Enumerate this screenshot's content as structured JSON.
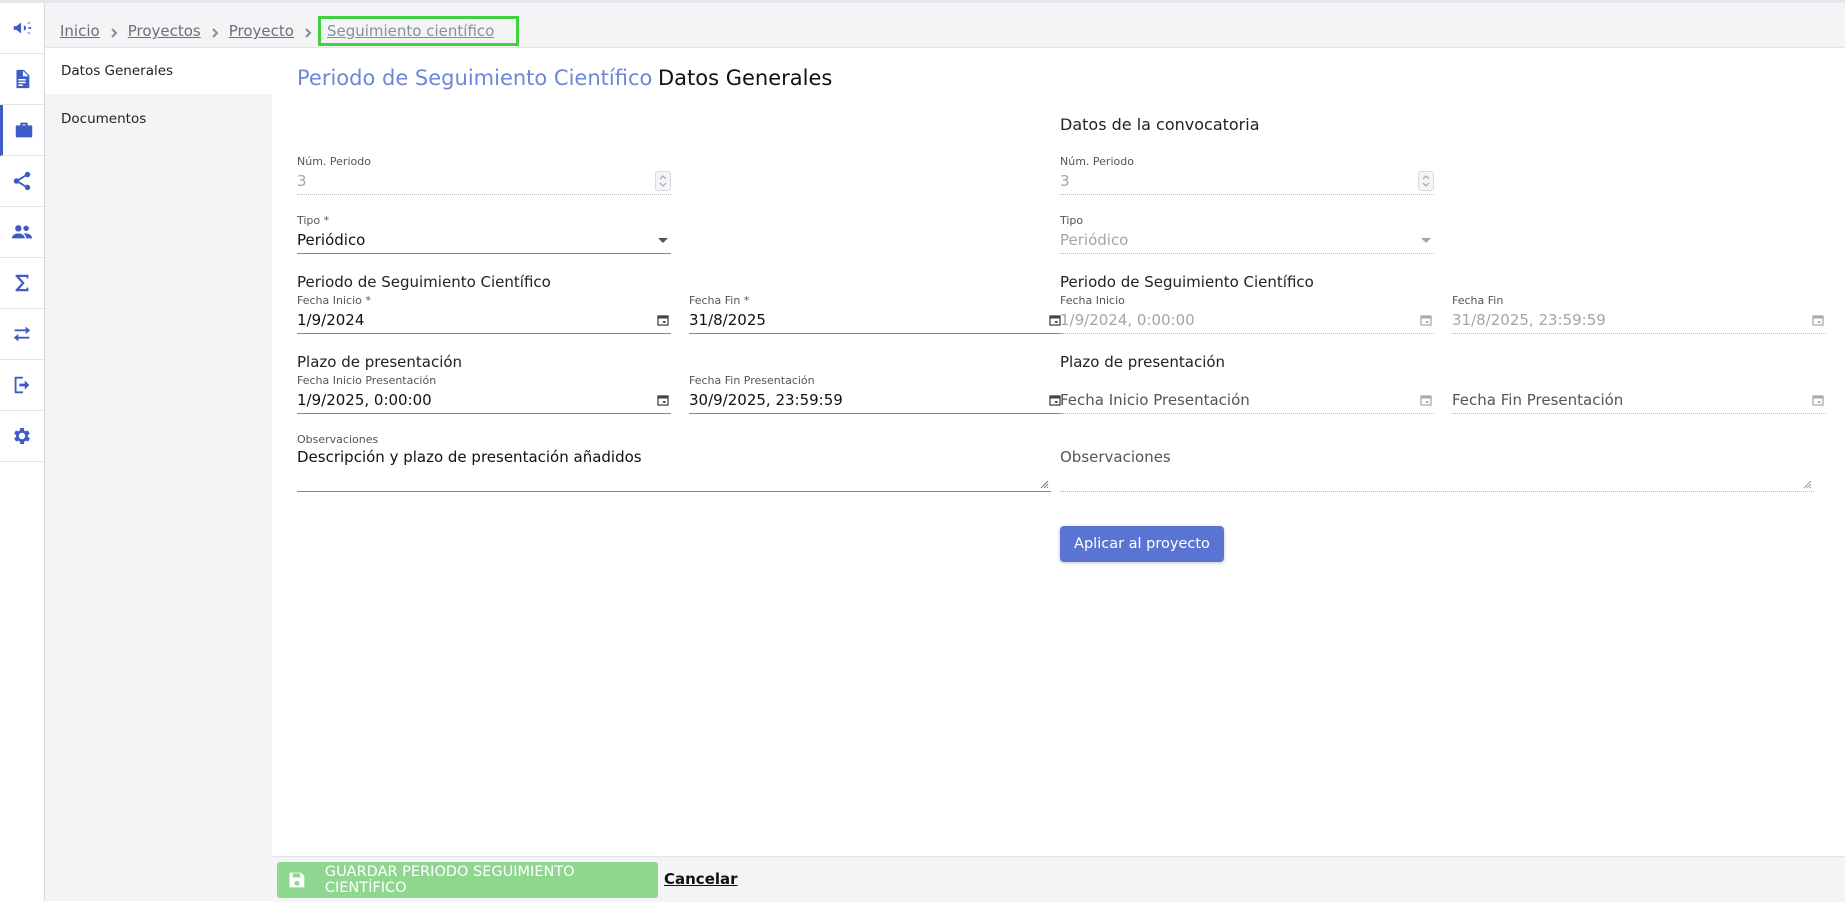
{
  "breadcrumb": {
    "items": [
      "Inicio",
      "Proyectos",
      "Proyecto"
    ],
    "current": "Seguimiento científico"
  },
  "rail": {
    "icons": [
      "megaphone-icon",
      "document-icon",
      "briefcase-icon",
      "share-icon",
      "people-icon",
      "sigma-icon",
      "transfer-icon",
      "logout-icon",
      "gear-icon"
    ],
    "active_index": 2
  },
  "sidenav": {
    "items": [
      "Datos Generales",
      "Documentos"
    ]
  },
  "page": {
    "title_primary": "Periodo de Seguimiento Científico",
    "title_secondary": "Datos Generales"
  },
  "left": {
    "num_periodo_label": "Núm. Periodo",
    "num_periodo_value": "3",
    "tipo_label": "Tipo *",
    "tipo_value": "Periódico",
    "periodo_heading": "Periodo de Seguimiento Científico",
    "fecha_inicio_label": "Fecha Inicio *",
    "fecha_inicio_value": "1/9/2024",
    "fecha_fin_label": "Fecha Fin *",
    "fecha_fin_value": "31/8/2025",
    "plazo_heading": "Plazo de presentación",
    "fecha_inicio_pres_label": "Fecha Inicio Presentación",
    "fecha_inicio_pres_value": "1/9/2025, 0:00:00",
    "fecha_fin_pres_label": "Fecha Fin Presentación",
    "fecha_fin_pres_value": "30/9/2025, 23:59:59",
    "observaciones_label": "Observaciones",
    "observaciones_value": "Descripción y plazo de presentación añadidos"
  },
  "right": {
    "heading": "Datos de la convocatoria",
    "num_periodo_label": "Núm. Periodo",
    "num_periodo_value": "3",
    "tipo_label": "Tipo",
    "tipo_value": "Periódico",
    "periodo_heading": "Periodo de Seguimiento Científico",
    "fecha_inicio_label": "Fecha Inicio",
    "fecha_inicio_value": "1/9/2024, 0:00:00",
    "fecha_fin_label": "Fecha Fin",
    "fecha_fin_value": "31/8/2025, 23:59:59",
    "plazo_heading": "Plazo de presentación",
    "fecha_inicio_pres_placeholder": "Fecha Inicio Presentación",
    "fecha_fin_pres_placeholder": "Fecha Fin Presentación",
    "observaciones_placeholder": "Observaciones",
    "apply_label": "Aplicar al proyecto"
  },
  "footer": {
    "save_label": "GUARDAR PERIODO SEGUIMIENTO CIENTÍFICO",
    "cancel_label": "Cancelar"
  },
  "colors": {
    "primary": "#3f5cc6",
    "title_accent": "#6d87d8",
    "apply_button": "#5a74d3",
    "save_button": "#8fd68f",
    "breadcrumb_highlight": "#3fd13f"
  }
}
